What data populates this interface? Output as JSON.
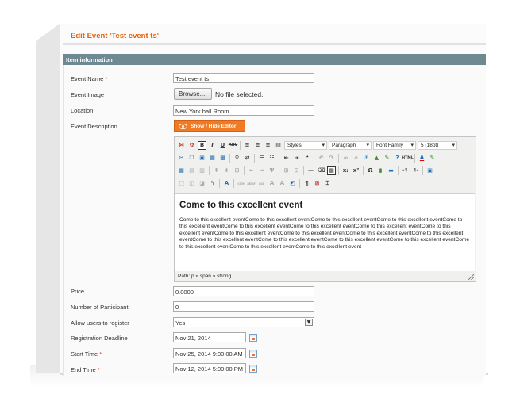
{
  "header": {
    "title": "Edit Event 'Test event ts'"
  },
  "section": {
    "title": "Item information"
  },
  "fields": {
    "event_name": {
      "label": "Event Name",
      "required": "*",
      "value": "Test event ts"
    },
    "event_image": {
      "label": "Event Image",
      "browse_label": "Browse...",
      "status": "No file selected."
    },
    "location": {
      "label": "Location",
      "value": "New York  ball Room"
    },
    "description": {
      "label": "Event Description",
      "toggle_label": "Show / Hide Editor"
    },
    "price": {
      "label": "Price",
      "value": "0.0000"
    },
    "participants": {
      "label": "Number of Participant",
      "value": "0"
    },
    "allow_register": {
      "label": "Allow users to register",
      "value": "Yes"
    },
    "reg_deadline": {
      "label": "Registration Deadline",
      "value": "Nov 21, 2014"
    },
    "start_time": {
      "label": "Start Time",
      "required": "*",
      "value": "Nov 25, 2014 9:00:00 AM"
    },
    "end_time": {
      "label": "End Time",
      "required": "*",
      "value": "Nov 12, 2014 5:00:00 PM"
    }
  },
  "editor": {
    "styles_select": "Styles",
    "format_select": "Paragraph",
    "font_family_select": "Font Family",
    "font_size_select": "5 (18pt)",
    "content_heading": "Come to this excellent event",
    "content_body": "Come to this excellent eventCome to this excellent eventCome to this excellent eventCome to this excellent eventCome to this excellent eventCome to this excellent eventCome to this excellent eventCome to this excellent eventCome to this excellent eventCome to this excellent eventCome to this excellent eventCome to this excellent eventCome to this excellent eventCome to this excellent eventCome to this excellent eventCome to this excellent eventCome to this excellent eventCome to this excellent eventCome to this excellent eventCome to this excellent event",
    "path": "Path: p » span » strong"
  },
  "icons": {
    "save": "💾",
    "bold": "B",
    "italic": "I",
    "underline": "U",
    "strike": "ABC"
  },
  "colors": {
    "accent": "#eb5e00",
    "section_bar": "#6f8992",
    "toggle": "#f17a24"
  }
}
